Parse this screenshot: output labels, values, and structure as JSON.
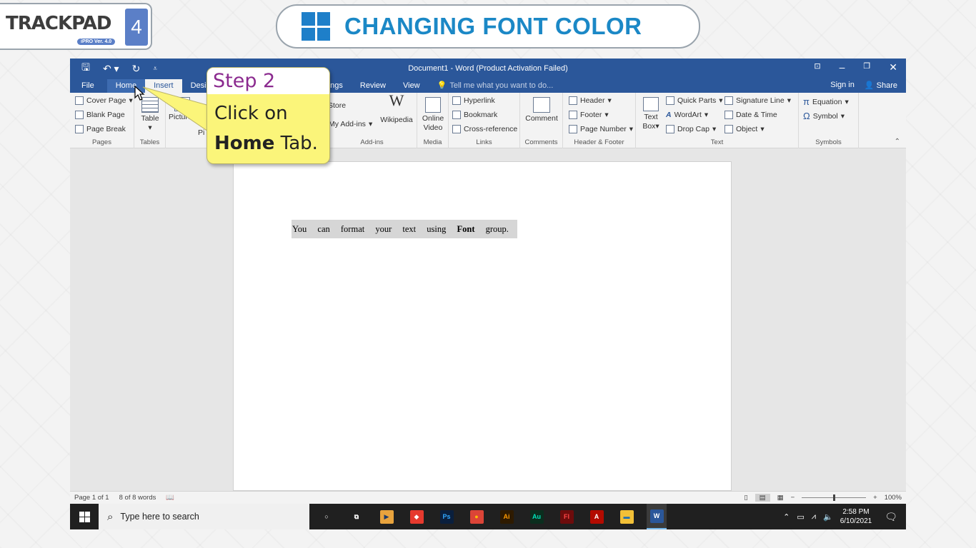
{
  "brand": {
    "name": "TRACKPAD",
    "edition": "4",
    "version": "iPRO Ver. 4.0"
  },
  "banner": {
    "title": "CHANGING FONT COLOR",
    "icon": "windows-logo-icon",
    "color": "#1b88c6"
  },
  "word": {
    "window_title": "Document1 - Word (Product Activation Failed)",
    "tabs": [
      "File",
      "Home",
      "Insert",
      "Desig",
      "ailings",
      "Review",
      "View"
    ],
    "active_tab": "Insert",
    "tell_me": "Tell me what you want to do...",
    "sign_in": "Sign in",
    "share": "Share",
    "ribbon": {
      "pages": {
        "label": "Pages",
        "cover_page": "Cover Page",
        "blank_page": "Blank Page",
        "page_break": "Page Break"
      },
      "tables": {
        "label": "Tables",
        "table": "Table"
      },
      "illustrations": {
        "pictures": "Pictures",
        "partial_1": "O",
        "partial_2": "Pi"
      },
      "addins": {
        "label": "Add-ins",
        "store": "Store",
        "my_addins": "My Add-ins",
        "wikipedia": "Wikipedia"
      },
      "media": {
        "label": "Media",
        "online_video_1": "Online",
        "online_video_2": "Video"
      },
      "links": {
        "label": "Links",
        "hyperlink": "Hyperlink",
        "bookmark": "Bookmark",
        "cross_reference": "Cross-reference"
      },
      "comments": {
        "label": "Comments",
        "comment": "Comment"
      },
      "header_footer": {
        "label": "Header & Footer",
        "header": "Header",
        "footer": "Footer",
        "page_number": "Page Number"
      },
      "text": {
        "label": "Text",
        "text_box_1": "Text",
        "text_box_2": "Box",
        "quick_parts": "Quick Parts",
        "wordart": "WordArt",
        "drop_cap": "Drop Cap",
        "signature_line": "Signature Line",
        "date_time": "Date & Time",
        "object": "Object"
      },
      "symbols": {
        "label": "Symbols",
        "equation": "Equation",
        "symbol": "Symbol"
      }
    },
    "document": {
      "words": [
        "You",
        "can",
        "format",
        "your",
        "text",
        "using",
        "Font",
        "group."
      ],
      "bold_word": "Font"
    },
    "status": {
      "page": "Page 1 of 1",
      "words": "8 of 8 words",
      "zoom": "100%"
    }
  },
  "taskbar": {
    "search_placeholder": "Type here to search",
    "time": "2:58 PM",
    "date": "6/10/2021",
    "apps": [
      {
        "name": "cortana-icon",
        "label": "○",
        "bg": "transparent",
        "fg": "#ffffff"
      },
      {
        "name": "task-view-icon",
        "label": "⧉",
        "bg": "transparent",
        "fg": "#ffffff"
      },
      {
        "name": "media-player-icon",
        "label": "▶",
        "bg": "#e8a33d",
        "fg": "#1c3a6b"
      },
      {
        "name": "anydesk-icon",
        "label": "◆",
        "bg": "#e63a2e",
        "fg": "#ffffff"
      },
      {
        "name": "photoshop-icon",
        "label": "Ps",
        "bg": "#0a1f3d",
        "fg": "#31a8ff"
      },
      {
        "name": "chrome-icon",
        "label": "●",
        "bg": "#db4437",
        "fg": "#fbbc05"
      },
      {
        "name": "illustrator-icon",
        "label": "Ai",
        "bg": "#2e1a00",
        "fg": "#ff9a00"
      },
      {
        "name": "audition-icon",
        "label": "Au",
        "bg": "#0b2e1e",
        "fg": "#00e4bb"
      },
      {
        "name": "flash-icon",
        "label": "Fl",
        "bg": "#6d0c0c",
        "fg": "#ff4545"
      },
      {
        "name": "acrobat-icon",
        "label": "A",
        "bg": "#b30b00",
        "fg": "#ffffff"
      },
      {
        "name": "file-explorer-icon",
        "label": "▬",
        "bg": "#f2c037",
        "fg": "#1c6fb5"
      },
      {
        "name": "word-icon",
        "label": "W",
        "bg": "#2b579a",
        "fg": "#ffffff"
      }
    ]
  },
  "callout": {
    "step": "Step 2",
    "line1": "Click on",
    "bold": "Home",
    "tail": " Tab."
  }
}
